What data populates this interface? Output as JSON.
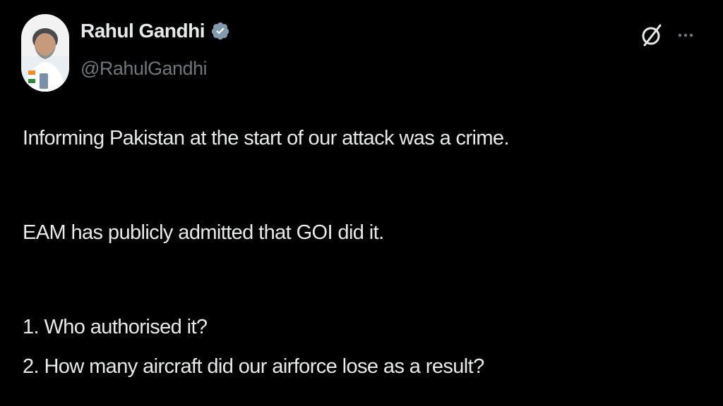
{
  "tweet": {
    "author": {
      "display_name": "Rahul Gandhi",
      "handle": "@RahulGandhi",
      "verified": true,
      "verified_icon": "verified-badge-icon"
    },
    "actions": {
      "grok_icon": "grok-icon",
      "more_icon": "more-options-icon"
    },
    "paragraphs": [
      "Informing Pakistan at the start of our attack was a crime.",
      "EAM has publicly admitted that GOI did it.",
      "1. Who authorised it?",
      "2. How many aircraft did our airforce lose as a result?"
    ],
    "colors": {
      "background": "#000000",
      "text": "#e7e9ea",
      "secondary_text": "#71767b",
      "verified_badge": "#829aab"
    }
  }
}
